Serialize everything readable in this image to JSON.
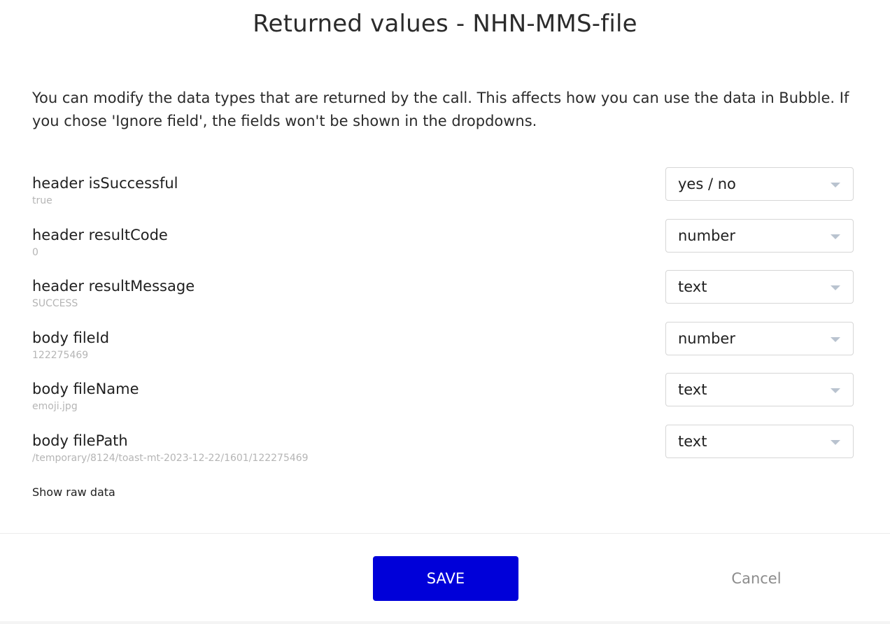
{
  "dialog": {
    "title": "Returned values - NHN-MMS-file",
    "description": "You can modify the data types that are returned by the call. This affects how you can use the data in Bubble. If you chose 'Ignore field', the fields won't be shown in the dropdowns."
  },
  "fields": [
    {
      "label": "header isSuccessful",
      "sample": "true",
      "type": "yes / no"
    },
    {
      "label": "header resultCode",
      "sample": "0",
      "type": "number"
    },
    {
      "label": "header resultMessage",
      "sample": "SUCCESS",
      "type": "text"
    },
    {
      "label": "body fileId",
      "sample": "122275469",
      "type": "number"
    },
    {
      "label": "body fileName",
      "sample": "emoji.jpg",
      "type": "text"
    },
    {
      "label": "body filePath",
      "sample": "/temporary/8124/toast-mt-2023-12-22/1601/122275469",
      "type": "text"
    }
  ],
  "links": {
    "show_raw": "Show raw data"
  },
  "footer": {
    "save_label": "SAVE",
    "cancel_label": "Cancel"
  },
  "colors": {
    "save_button": "#0000d9",
    "cancel_text": "#8c8c8c",
    "sample_text": "#b5b5b5",
    "caret": "#b9c3cf"
  },
  "icons": {
    "dropdown": "chevron-down-icon"
  }
}
